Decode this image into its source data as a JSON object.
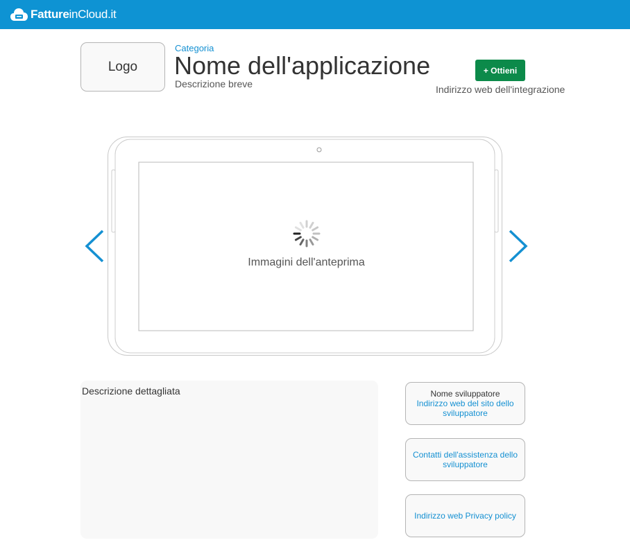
{
  "header": {
    "brand_bold": "Fatture",
    "brand_light": "inCloud.it",
    "brand_color": "#0e93d3"
  },
  "app": {
    "logo_label": "Logo",
    "category": "Categoria",
    "name": "Nome dell'applicazione",
    "short_description": "Descrizione breve",
    "get_button_label": "+ Ottieni",
    "get_button_color": "#0c8a4a",
    "integration_url": "Indirizzo web dell'integrazione"
  },
  "preview": {
    "label": "Immagini dell'anteprima",
    "prev_icon": "chevron-left-icon",
    "next_icon": "chevron-right-icon",
    "arrow_color": "#1490d2"
  },
  "details": {
    "label": "Descrizione dettagliata"
  },
  "developer": {
    "name": "Nome sviluppatore",
    "website": "Indirizzo web del sito dello sviluppatore",
    "support": "Contatti dell'assistenza dello sviluppatore",
    "privacy": "Indirizzo web Privacy policy"
  }
}
